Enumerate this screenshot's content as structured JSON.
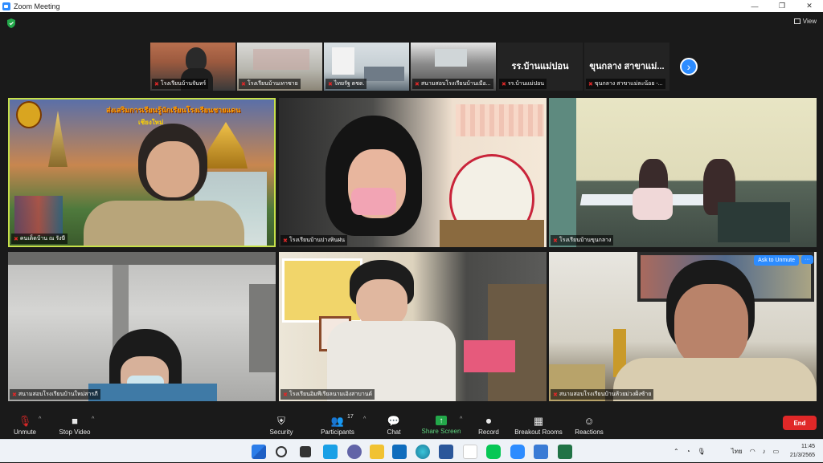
{
  "window": {
    "title": "Zoom Meeting",
    "minimize": "—",
    "maximize": "❐",
    "close": "✕"
  },
  "top": {
    "view_label": "View"
  },
  "thumbnails": [
    {
      "name": "โรงเรียนบ้านจันทร์",
      "big": ""
    },
    {
      "name": "โรงเรียนบ้านเทาซาย",
      "big": ""
    },
    {
      "name": "ไทยรัฐ ตชด.",
      "big": ""
    },
    {
      "name": "สนามสอบโรงเรียนบ้านเมือ...",
      "big": ""
    },
    {
      "name": "รร.บ้านแม่ปอน",
      "big": "รร.บ้านแม่ปอน"
    },
    {
      "name": "ขุนกลาง สาขาแม่ละน้อย -...",
      "big": "ขุนกลาง สาขาแม่..."
    }
  ],
  "tiles": [
    {
      "name": "คนเด็ดบ้าน ณ รังษี",
      "banner": "ส่งเสริมการเรียนรู้นักเรียนโรงเรียนชายแดน",
      "banner2": "เชียงใหม่"
    },
    {
      "name": "โรงเรียนบ้านปางหินฝน"
    },
    {
      "name": "โรงเรียนบ้านขุนกลาง"
    },
    {
      "name": "สนามสอบโรงเรียนบ้านใหม่สารภี"
    },
    {
      "name": "โรงเรียนอิมพีเรียลนามเอิงสาบานด์"
    },
    {
      "name": "สนามสอบโรงเรียนบ้านห้วยม่วงฝั่งซ้าย",
      "ask": "Ask to Unmute",
      "more": "···"
    }
  ],
  "toolbar": {
    "unmute": "Unmute",
    "stop_video": "Stop Video",
    "security": "Security",
    "participants": "Participants",
    "participants_count": "17",
    "chat": "Chat",
    "share_screen": "Share Screen",
    "record": "Record",
    "breakout_rooms": "Breakout Rooms",
    "reactions": "Reactions",
    "end": "End"
  },
  "taskbar": {
    "lang": "ไทย",
    "time": "11:45",
    "date": "21/3/2565"
  },
  "colors": {
    "accent": "#2d8cff",
    "end": "#e02828",
    "share": "#23a84a",
    "active_border": "#c6e04a"
  }
}
